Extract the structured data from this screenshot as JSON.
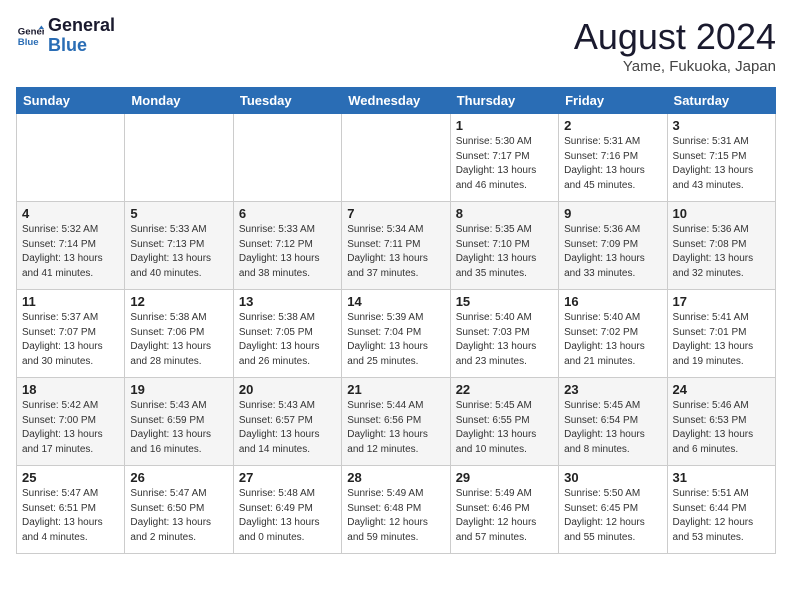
{
  "logo": {
    "line1": "General",
    "line2": "Blue"
  },
  "title": "August 2024",
  "subtitle": "Yame, Fukuoka, Japan",
  "weekdays": [
    "Sunday",
    "Monday",
    "Tuesday",
    "Wednesday",
    "Thursday",
    "Friday",
    "Saturday"
  ],
  "weeks": [
    [
      {
        "day": "",
        "info": ""
      },
      {
        "day": "",
        "info": ""
      },
      {
        "day": "",
        "info": ""
      },
      {
        "day": "",
        "info": ""
      },
      {
        "day": "1",
        "info": "Sunrise: 5:30 AM\nSunset: 7:17 PM\nDaylight: 13 hours\nand 46 minutes."
      },
      {
        "day": "2",
        "info": "Sunrise: 5:31 AM\nSunset: 7:16 PM\nDaylight: 13 hours\nand 45 minutes."
      },
      {
        "day": "3",
        "info": "Sunrise: 5:31 AM\nSunset: 7:15 PM\nDaylight: 13 hours\nand 43 minutes."
      }
    ],
    [
      {
        "day": "4",
        "info": "Sunrise: 5:32 AM\nSunset: 7:14 PM\nDaylight: 13 hours\nand 41 minutes."
      },
      {
        "day": "5",
        "info": "Sunrise: 5:33 AM\nSunset: 7:13 PM\nDaylight: 13 hours\nand 40 minutes."
      },
      {
        "day": "6",
        "info": "Sunrise: 5:33 AM\nSunset: 7:12 PM\nDaylight: 13 hours\nand 38 minutes."
      },
      {
        "day": "7",
        "info": "Sunrise: 5:34 AM\nSunset: 7:11 PM\nDaylight: 13 hours\nand 37 minutes."
      },
      {
        "day": "8",
        "info": "Sunrise: 5:35 AM\nSunset: 7:10 PM\nDaylight: 13 hours\nand 35 minutes."
      },
      {
        "day": "9",
        "info": "Sunrise: 5:36 AM\nSunset: 7:09 PM\nDaylight: 13 hours\nand 33 minutes."
      },
      {
        "day": "10",
        "info": "Sunrise: 5:36 AM\nSunset: 7:08 PM\nDaylight: 13 hours\nand 32 minutes."
      }
    ],
    [
      {
        "day": "11",
        "info": "Sunrise: 5:37 AM\nSunset: 7:07 PM\nDaylight: 13 hours\nand 30 minutes."
      },
      {
        "day": "12",
        "info": "Sunrise: 5:38 AM\nSunset: 7:06 PM\nDaylight: 13 hours\nand 28 minutes."
      },
      {
        "day": "13",
        "info": "Sunrise: 5:38 AM\nSunset: 7:05 PM\nDaylight: 13 hours\nand 26 minutes."
      },
      {
        "day": "14",
        "info": "Sunrise: 5:39 AM\nSunset: 7:04 PM\nDaylight: 13 hours\nand 25 minutes."
      },
      {
        "day": "15",
        "info": "Sunrise: 5:40 AM\nSunset: 7:03 PM\nDaylight: 13 hours\nand 23 minutes."
      },
      {
        "day": "16",
        "info": "Sunrise: 5:40 AM\nSunset: 7:02 PM\nDaylight: 13 hours\nand 21 minutes."
      },
      {
        "day": "17",
        "info": "Sunrise: 5:41 AM\nSunset: 7:01 PM\nDaylight: 13 hours\nand 19 minutes."
      }
    ],
    [
      {
        "day": "18",
        "info": "Sunrise: 5:42 AM\nSunset: 7:00 PM\nDaylight: 13 hours\nand 17 minutes."
      },
      {
        "day": "19",
        "info": "Sunrise: 5:43 AM\nSunset: 6:59 PM\nDaylight: 13 hours\nand 16 minutes."
      },
      {
        "day": "20",
        "info": "Sunrise: 5:43 AM\nSunset: 6:57 PM\nDaylight: 13 hours\nand 14 minutes."
      },
      {
        "day": "21",
        "info": "Sunrise: 5:44 AM\nSunset: 6:56 PM\nDaylight: 13 hours\nand 12 minutes."
      },
      {
        "day": "22",
        "info": "Sunrise: 5:45 AM\nSunset: 6:55 PM\nDaylight: 13 hours\nand 10 minutes."
      },
      {
        "day": "23",
        "info": "Sunrise: 5:45 AM\nSunset: 6:54 PM\nDaylight: 13 hours\nand 8 minutes."
      },
      {
        "day": "24",
        "info": "Sunrise: 5:46 AM\nSunset: 6:53 PM\nDaylight: 13 hours\nand 6 minutes."
      }
    ],
    [
      {
        "day": "25",
        "info": "Sunrise: 5:47 AM\nSunset: 6:51 PM\nDaylight: 13 hours\nand 4 minutes."
      },
      {
        "day": "26",
        "info": "Sunrise: 5:47 AM\nSunset: 6:50 PM\nDaylight: 13 hours\nand 2 minutes."
      },
      {
        "day": "27",
        "info": "Sunrise: 5:48 AM\nSunset: 6:49 PM\nDaylight: 13 hours\nand 0 minutes."
      },
      {
        "day": "28",
        "info": "Sunrise: 5:49 AM\nSunset: 6:48 PM\nDaylight: 12 hours\nand 59 minutes."
      },
      {
        "day": "29",
        "info": "Sunrise: 5:49 AM\nSunset: 6:46 PM\nDaylight: 12 hours\nand 57 minutes."
      },
      {
        "day": "30",
        "info": "Sunrise: 5:50 AM\nSunset: 6:45 PM\nDaylight: 12 hours\nand 55 minutes."
      },
      {
        "day": "31",
        "info": "Sunrise: 5:51 AM\nSunset: 6:44 PM\nDaylight: 12 hours\nand 53 minutes."
      }
    ]
  ]
}
